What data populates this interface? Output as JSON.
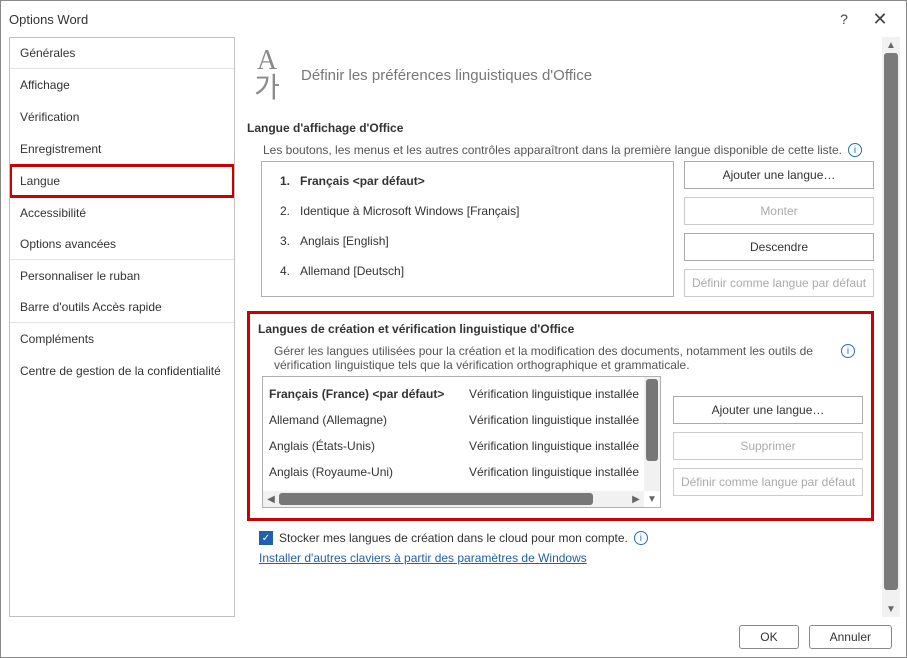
{
  "title": "Options Word",
  "titlebar": {
    "help": "?",
    "close": "✕"
  },
  "sidebar": {
    "items": [
      {
        "label": "Générales",
        "highlight": false,
        "sep": true
      },
      {
        "label": "Affichage",
        "highlight": false,
        "sep": false
      },
      {
        "label": "Vérification",
        "highlight": false,
        "sep": false
      },
      {
        "label": "Enregistrement",
        "highlight": false,
        "sep": false
      },
      {
        "label": "Langue",
        "highlight": true,
        "sep": false
      },
      {
        "label": "Accessibilité",
        "highlight": false,
        "sep": false
      },
      {
        "label": "Options avancées",
        "highlight": false,
        "sep": true
      },
      {
        "label": "Personnaliser le ruban",
        "highlight": false,
        "sep": false
      },
      {
        "label": "Barre d'outils Accès rapide",
        "highlight": false,
        "sep": true
      },
      {
        "label": "Compléments",
        "highlight": false,
        "sep": false
      },
      {
        "label": "Centre de gestion de la confidentialité",
        "highlight": false,
        "sep": false
      }
    ]
  },
  "header": {
    "icon_letters": "A가",
    "title": "Définir les préférences linguistiques d'Office"
  },
  "display_lang": {
    "heading": "Langue d'affichage d'Office",
    "help": "Les boutons, les menus et les autres contrôles apparaîtront dans la première langue disponible de cette liste.",
    "items": [
      {
        "n": "1.",
        "label": "Français <par défaut>",
        "strong": true
      },
      {
        "n": "2.",
        "label": "Identique à Microsoft Windows [Français]",
        "strong": false
      },
      {
        "n": "3.",
        "label": "Anglais [English]",
        "strong": false
      },
      {
        "n": "4.",
        "label": "Allemand [Deutsch]",
        "strong": false
      }
    ],
    "buttons": {
      "add": "Ajouter une langue…",
      "up": "Monter",
      "down": "Descendre",
      "default": "Définir comme langue par défaut"
    }
  },
  "authoring": {
    "heading": "Langues de création et vérification linguistique d'Office",
    "help": "Gérer les langues utilisées pour la création et la modification des documents, notamment les outils de vérification linguistique tels que la vérification orthographique et grammaticale.",
    "items": [
      {
        "name": "Français (France) <par défaut>",
        "status": "Vérification linguistique installée",
        "strong": true
      },
      {
        "name": "Allemand (Allemagne)",
        "status": "Vérification linguistique installée",
        "strong": false
      },
      {
        "name": "Anglais (États-Unis)",
        "status": "Vérification linguistique installée",
        "strong": false
      },
      {
        "name": "Anglais (Royaume-Uni)",
        "status": "Vérification linguistique installée",
        "strong": false
      }
    ],
    "buttons": {
      "add": "Ajouter une langue…",
      "remove": "Supprimer",
      "default": "Définir comme langue par défaut"
    }
  },
  "cloud_cb": "Stocker mes langues de création dans le cloud pour mon compte.",
  "kb_link": "Installer d'autres claviers à partir des paramètres de Windows",
  "footer": {
    "ok": "OK",
    "cancel": "Annuler"
  }
}
